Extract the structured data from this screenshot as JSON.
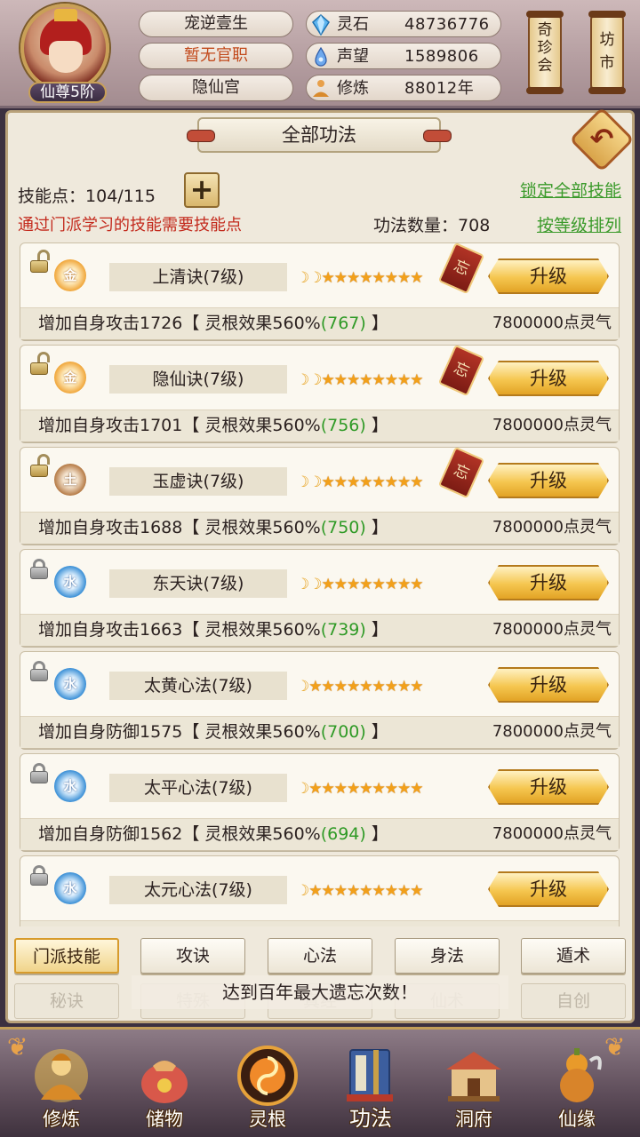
{
  "header": {
    "rank": "仙尊5阶",
    "player_name": "宠逆壹生",
    "official_post": "暂无官职",
    "sect": "隐仙宫",
    "resources": [
      {
        "label": "灵石",
        "value": "48736776",
        "icon": "crystal-icon"
      },
      {
        "label": "声望",
        "value": "1589806",
        "icon": "drop-icon"
      },
      {
        "label": "修炼",
        "value": "88012年",
        "icon": "meditate-icon"
      }
    ],
    "shops": [
      {
        "label": "奇珍会"
      },
      {
        "label": "坊市"
      }
    ]
  },
  "panel": {
    "title": "全部功法",
    "skill_points_label": "技能点：",
    "skill_points_value": "104/115",
    "plus_label": "+",
    "lock_all_link": "锁定全部技能",
    "note": "通过门派学习的技能需要技能点",
    "count_label": "功法数量：",
    "count_value": "708",
    "sort_link": "按等级排列"
  },
  "skills": [
    {
      "name": "上清诀(7级)",
      "element": "金",
      "element_type": "gold",
      "locked": false,
      "moons": 2,
      "stars": 8,
      "forget": "忘",
      "upgrade": "升级",
      "desc_prefix": "增加自身攻击1726【 灵根效果560%",
      "desc_bonus": "(767)",
      "desc_suffix": " 】",
      "cost": "7800000点灵气"
    },
    {
      "name": "隐仙诀(7级)",
      "element": "金",
      "element_type": "gold",
      "locked": false,
      "moons": 2,
      "stars": 8,
      "forget": "忘",
      "upgrade": "升级",
      "desc_prefix": "增加自身攻击1701【 灵根效果560%",
      "desc_bonus": "(756)",
      "desc_suffix": " 】",
      "cost": "7800000点灵气"
    },
    {
      "name": "玉虚诀(7级)",
      "element": "土",
      "element_type": "earth",
      "locked": false,
      "moons": 2,
      "stars": 8,
      "forget": "忘",
      "upgrade": "升级",
      "desc_prefix": "增加自身攻击1688【 灵根效果560%",
      "desc_bonus": "(750)",
      "desc_suffix": " 】",
      "cost": "7800000点灵气"
    },
    {
      "name": "东天诀(7级)",
      "element": "水",
      "element_type": "water",
      "locked": true,
      "moons": 2,
      "stars": 8,
      "forget": "",
      "upgrade": "升级",
      "desc_prefix": "增加自身攻击1663【 灵根效果560%",
      "desc_bonus": "(739)",
      "desc_suffix": " 】",
      "cost": "7800000点灵气"
    },
    {
      "name": "太黄心法(7级)",
      "element": "水",
      "element_type": "water",
      "locked": true,
      "moons": 1,
      "stars": 9,
      "forget": "",
      "upgrade": "升级",
      "desc_prefix": "增加自身防御1575【 灵根效果560%",
      "desc_bonus": "(700)",
      "desc_suffix": " 】",
      "cost": "7800000点灵气"
    },
    {
      "name": "太平心法(7级)",
      "element": "水",
      "element_type": "water",
      "locked": true,
      "moons": 1,
      "stars": 9,
      "forget": "",
      "upgrade": "升级",
      "desc_prefix": "增加自身防御1562【 灵根效果560%",
      "desc_bonus": "(694)",
      "desc_suffix": " 】",
      "cost": "7800000点灵气"
    },
    {
      "name": "太元心法(7级)",
      "element": "水",
      "element_type": "water",
      "locked": true,
      "moons": 1,
      "stars": 9,
      "forget": "",
      "upgrade": "升级",
      "desc_prefix": "",
      "desc_bonus": "",
      "desc_suffix": "",
      "cost": ""
    }
  ],
  "tabs_row1": [
    {
      "label": "门派技能",
      "active": true
    },
    {
      "label": "攻诀",
      "active": false
    },
    {
      "label": "心法",
      "active": false
    },
    {
      "label": "身法",
      "active": false
    },
    {
      "label": "遁术",
      "active": false
    }
  ],
  "tabs_row2": [
    {
      "label": "秘诀"
    },
    {
      "label": "特殊"
    },
    {
      "label": "真经"
    },
    {
      "label": "仙术"
    },
    {
      "label": "自创"
    }
  ],
  "toast": "达到百年最大遗忘次数！",
  "nav": [
    {
      "label": "修炼",
      "icon": "cultivation-icon",
      "active": false
    },
    {
      "label": "储物",
      "icon": "storage-bag-icon",
      "active": false
    },
    {
      "label": "灵根",
      "icon": "spirit-root-icon",
      "active": false
    },
    {
      "label": "功法",
      "icon": "skill-book-icon",
      "active": true
    },
    {
      "label": "洞府",
      "icon": "cave-house-icon",
      "active": false
    },
    {
      "label": "仙缘",
      "icon": "gourd-icon",
      "active": false
    }
  ],
  "colors": {
    "accent_green": "#2f9a26",
    "note_red": "#c3291c",
    "official_orange": "#c24a1c",
    "upgrade_gold": "#f5c64f"
  }
}
